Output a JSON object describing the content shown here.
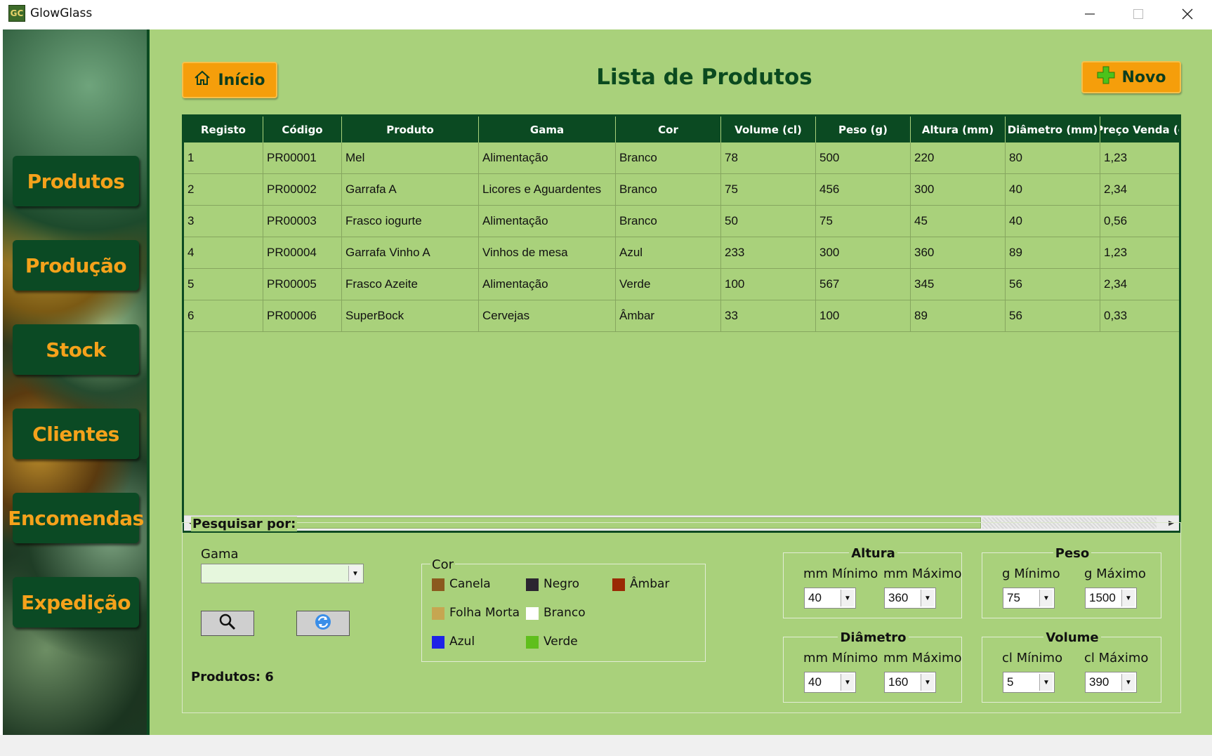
{
  "window": {
    "title": "GlowGlass",
    "icon_text": "GC",
    "controls": [
      "minimize-icon",
      "maximize-icon",
      "close-icon"
    ]
  },
  "sidebar": {
    "items": [
      {
        "label": "Produtos"
      },
      {
        "label": "Produção"
      },
      {
        "label": "Stock"
      },
      {
        "label": "Clientes"
      },
      {
        "label": "Encomendas"
      },
      {
        "label": "Expedição"
      }
    ]
  },
  "header": {
    "home_label": "Início",
    "title": "Lista de Produtos",
    "new_label": "Novo"
  },
  "table": {
    "columns": [
      "Registo",
      "Código",
      "Produto",
      "Gama",
      "Cor",
      "Volume (cl)",
      "Peso (g)",
      "Altura (mm)",
      "Diâmetro (mm)",
      "Preço Venda (e"
    ],
    "rows": [
      [
        "1",
        "PR00001",
        "Mel",
        "Alimentação",
        "Branco",
        "78",
        "500",
        "220",
        "80",
        "1,23"
      ],
      [
        "2",
        "PR00002",
        "Garrafa A",
        "Licores e Aguardentes",
        "Branco",
        "75",
        "456",
        "300",
        "40",
        "2,34"
      ],
      [
        "3",
        "PR00003",
        "Frasco iogurte",
        "Alimentação",
        "Branco",
        "50",
        "75",
        "45",
        "40",
        "0,56"
      ],
      [
        "4",
        "PR00004",
        "Garrafa Vinho A",
        "Vinhos de mesa",
        "Azul",
        "233",
        "300",
        "360",
        "89",
        "1,23"
      ],
      [
        "5",
        "PR00005",
        "Frasco Azeite",
        "Alimentação",
        "Verde",
        "100",
        "567",
        "345",
        "56",
        "2,34"
      ],
      [
        "6",
        "PR00006",
        "SuperBock",
        "Cervejas",
        "Âmbar",
        "33",
        "100",
        "89",
        "56",
        "0,33"
      ]
    ]
  },
  "search": {
    "title": "Pesquisar por:",
    "gama_label": "Gama",
    "gama_value": "",
    "count_text": "Produtos: 6",
    "cor": {
      "title": "Cor",
      "options": [
        {
          "label": "Canela",
          "color": "#8b5a1e"
        },
        {
          "label": "Negro",
          "color": "#2b2530"
        },
        {
          "label": "Âmbar",
          "color": "#9a2a05"
        },
        {
          "label": "Folha Morta",
          "color": "#c6a651"
        },
        {
          "label": "Branco",
          "color": "#ffffff"
        },
        {
          "label": "Azul",
          "color": "#1e22e6"
        },
        {
          "label": "Verde",
          "color": "#5fbf1c"
        }
      ]
    },
    "altura": {
      "title": "Altura",
      "min_label": "mm Mínimo",
      "max_label": "mm Máximo",
      "min": "40",
      "max": "360"
    },
    "peso": {
      "title": "Peso",
      "min_label": "g Mínimo",
      "max_label": "g Máximo",
      "min": "75",
      "max": "1500"
    },
    "diametro": {
      "title": "Diâmetro",
      "min_label": "mm Mínimo",
      "max_label": "mm Máximo",
      "min": "40",
      "max": "160"
    },
    "volume": {
      "title": "Volume",
      "min_label": "cl Mínimo",
      "max_label": "cl Máximo",
      "min": "5",
      "max": "390"
    }
  },
  "colors": {
    "sidebar_button": "#0b4a24",
    "accent_orange": "#f59e0b",
    "background_green": "#a9d17b",
    "header_dark_green": "#0b4a22"
  }
}
